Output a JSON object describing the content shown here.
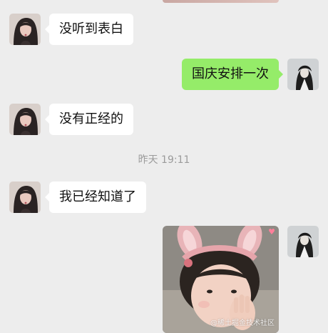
{
  "messages": [
    {
      "side": "left",
      "text": "没听到表白"
    },
    {
      "side": "right",
      "text": "国庆安排一次"
    },
    {
      "side": "left",
      "text": "没有正经的"
    },
    {
      "side": "left",
      "text": "我已经知道了"
    }
  ],
  "timestamp": "昨天 19:11",
  "watermark": "@稀土掘金技术社区",
  "icons": {
    "sticker_badge": "heart-icon"
  },
  "colors": {
    "background": "#ededed",
    "left_bubble": "#ffffff",
    "right_bubble": "#95ec69",
    "timestamp_text": "#9b9b9b"
  }
}
